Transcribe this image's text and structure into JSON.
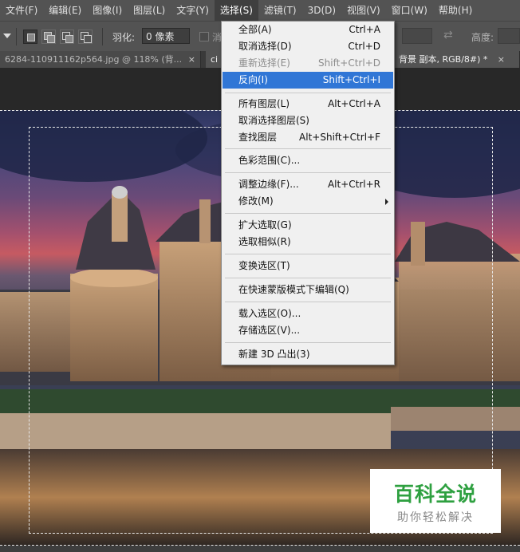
{
  "menubar": {
    "items": [
      "文件(F)",
      "编辑(E)",
      "图像(I)",
      "图层(L)",
      "文字(Y)",
      "选择(S)",
      "滤镜(T)",
      "3D(D)",
      "视图(V)",
      "窗口(W)",
      "帮助(H)"
    ],
    "active_index": 5
  },
  "options": {
    "feather_label": "羽化:",
    "feather_value": "0 像素",
    "clip_text": "消",
    "height_label": "高度:"
  },
  "tabs": [
    {
      "label": "6284-110911162p564.jpg @ 118% (背...",
      "close": "×"
    },
    {
      "label": "ci",
      "close": ""
    },
    {
      "label": "背景 副本, RGB/8#) *",
      "close": "×"
    }
  ],
  "select_menu": {
    "items": [
      {
        "label": "全部(A)",
        "shortcut": "Ctrl+A"
      },
      {
        "label": "取消选择(D)",
        "shortcut": "Ctrl+D"
      },
      {
        "label": "重新选择(E)",
        "shortcut": "Shift+Ctrl+D"
      },
      {
        "label": "反向(I)",
        "shortcut": "Shift+Ctrl+I"
      },
      {
        "label": "所有图层(L)",
        "shortcut": "Alt+Ctrl+A"
      },
      {
        "label": "取消选择图层(S)",
        "shortcut": ""
      },
      {
        "label": "查找图层",
        "shortcut": "Alt+Shift+Ctrl+F"
      },
      {
        "label": "色彩范围(C)...",
        "shortcut": ""
      },
      {
        "label": "调整边缘(F)...",
        "shortcut": "Alt+Ctrl+R"
      },
      {
        "label": "修改(M)",
        "shortcut": ""
      },
      {
        "label": "扩大选取(G)",
        "shortcut": ""
      },
      {
        "label": "选取相似(R)",
        "shortcut": ""
      },
      {
        "label": "变换选区(T)",
        "shortcut": ""
      },
      {
        "label": "在快速蒙版模式下编辑(Q)",
        "shortcut": ""
      },
      {
        "label": "载入选区(O)...",
        "shortcut": ""
      },
      {
        "label": "存储选区(V)...",
        "shortcut": ""
      },
      {
        "label": "新建 3D 凸出(3)",
        "shortcut": ""
      }
    ],
    "disabled_index": 2,
    "highlight_index": 3
  },
  "watermark": {
    "title": "百科全说",
    "subtitle": "助你轻松解决"
  },
  "colors": {
    "menu_highlight": "#3076d6",
    "watermark_green": "#2ea040"
  }
}
